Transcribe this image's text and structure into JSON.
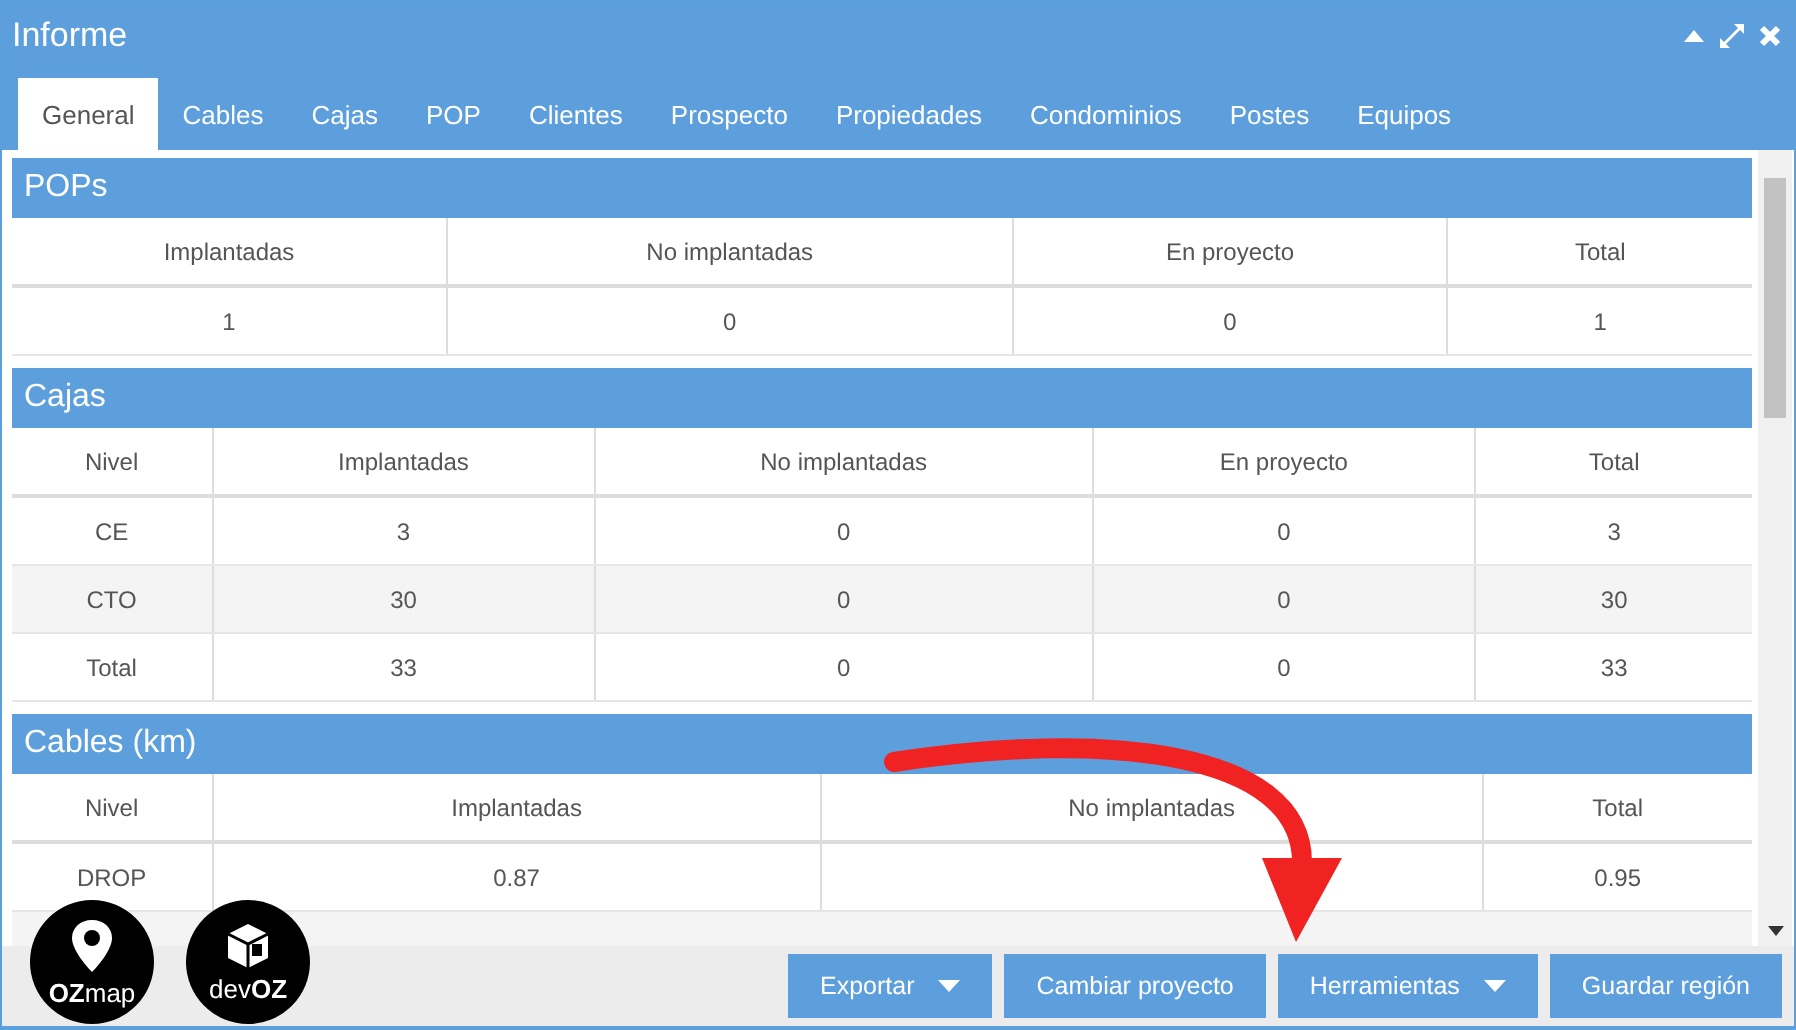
{
  "window": {
    "title": "Informe"
  },
  "tabs": [
    {
      "label": "General",
      "selected": true
    },
    {
      "label": "Cables",
      "selected": false
    },
    {
      "label": "Cajas",
      "selected": false
    },
    {
      "label": "POP",
      "selected": false
    },
    {
      "label": "Clientes",
      "selected": false
    },
    {
      "label": "Prospecto",
      "selected": false
    },
    {
      "label": "Propiedades",
      "selected": false
    },
    {
      "label": "Condominios",
      "selected": false
    },
    {
      "label": "Postes",
      "selected": false
    },
    {
      "label": "Equipos",
      "selected": false
    }
  ],
  "sections": [
    {
      "title": "POPs",
      "columns": [
        "Implantadas",
        "No implantadas",
        "En proyecto",
        "Total"
      ],
      "rows": [
        [
          "1",
          "0",
          "0",
          "1"
        ]
      ]
    },
    {
      "title": "Cajas",
      "columns": [
        "Nivel",
        "Implantadas",
        "No implantadas",
        "En proyecto",
        "Total"
      ],
      "rows": [
        [
          "CE",
          "3",
          "0",
          "0",
          "3"
        ],
        [
          "CTO",
          "30",
          "0",
          "0",
          "30"
        ],
        [
          "Total",
          "33",
          "0",
          "0",
          "33"
        ]
      ]
    },
    {
      "title": "Cables (km)",
      "columns": [
        "Nivel",
        "Implantadas",
        "No implantadas",
        "Total"
      ],
      "rows": [
        [
          "DROP",
          "0.87",
          null,
          "0.95"
        ]
      ]
    }
  ],
  "buttons": [
    {
      "label": "Exportar",
      "dropdown": true
    },
    {
      "label": "Cambiar proyecto",
      "dropdown": false
    },
    {
      "label": "Herramientas",
      "dropdown": true
    },
    {
      "label": "Guardar región",
      "dropdown": false
    }
  ],
  "logos": [
    "**OZ**map",
    "dev**OZ**"
  ]
}
